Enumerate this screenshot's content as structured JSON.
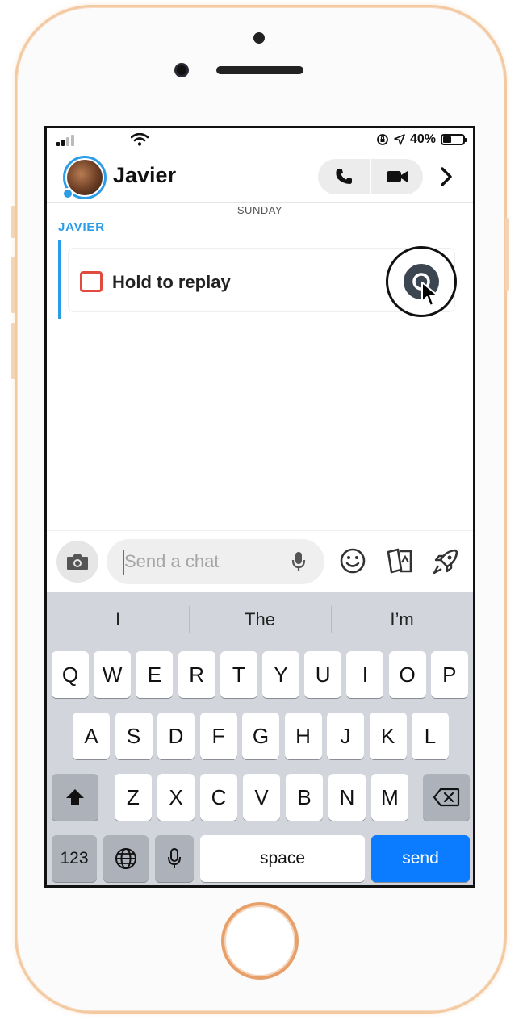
{
  "status_bar": {
    "battery": "40%",
    "battery_level": 0.4
  },
  "header": {
    "contact_name": "Javier"
  },
  "chat": {
    "day_label": "SUNDAY",
    "sender": "JAVIER",
    "message_text": "Hold to replay"
  },
  "input": {
    "placeholder": "Send a chat"
  },
  "keyboard": {
    "suggestions": [
      "I",
      "The",
      "I’m"
    ],
    "row1": [
      "Q",
      "W",
      "E",
      "R",
      "T",
      "Y",
      "U",
      "I",
      "O",
      "P"
    ],
    "row2": [
      "A",
      "S",
      "D",
      "F",
      "G",
      "H",
      "J",
      "K",
      "L"
    ],
    "row3": [
      "Z",
      "X",
      "C",
      "V",
      "B",
      "N",
      "M"
    ],
    "num_label": "123",
    "space_label": "space",
    "send_label": "send"
  },
  "colors": {
    "accent_blue": "#2a9ce8",
    "snap_red": "#e04a3f",
    "send_blue": "#0b7bff"
  }
}
